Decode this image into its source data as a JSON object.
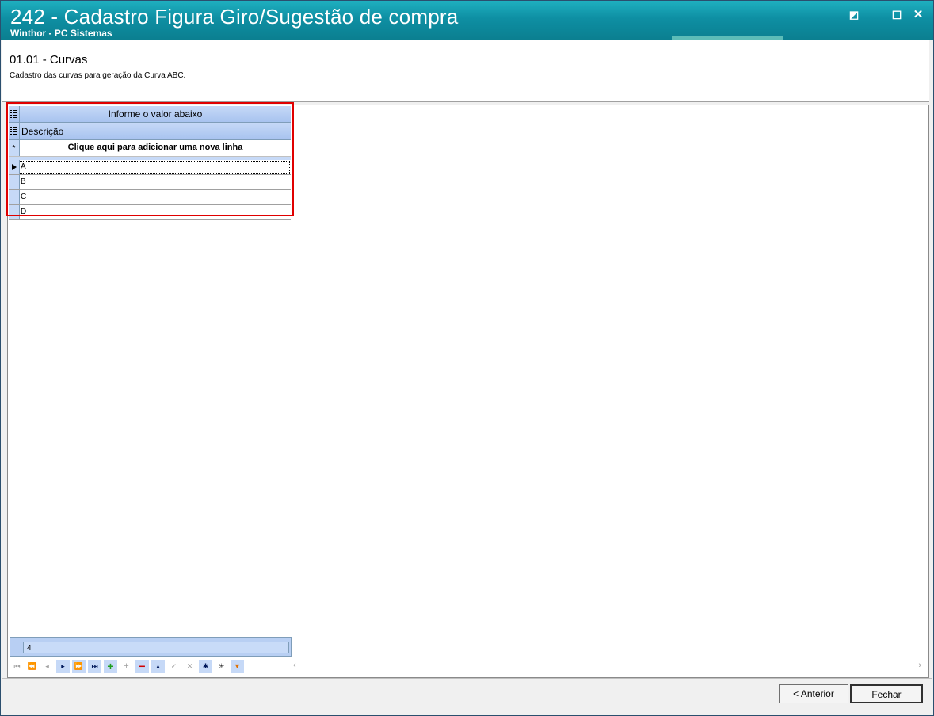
{
  "window": {
    "title": "242 - Cadastro Figura Giro/Sugestão de compra",
    "subtitle": "Winthor - PC Sistemas",
    "controls": {
      "restore": "◩",
      "minimize": "_",
      "maximize": "☐",
      "close": "✕"
    }
  },
  "step": {
    "title": "01.01 - Curvas",
    "description": "Cadastro das curvas para geração da Curva ABC."
  },
  "grid": {
    "group_header": "Informe o valor abaixo",
    "column_header": "Descrição",
    "new_row_text": "Clique aqui para adicionar uma nova linha",
    "new_row_indicator": "*",
    "rows": [
      {
        "descricao": "A"
      },
      {
        "descricao": "B"
      },
      {
        "descricao": "C"
      },
      {
        "descricao": "D"
      }
    ],
    "footer_count": "4"
  },
  "navigator": {
    "icons": [
      "first-icon",
      "prev-page-icon",
      "prev-icon",
      "next-icon",
      "next-page-icon",
      "last-icon",
      "insert-icon",
      "append-icon",
      "delete-icon",
      "edit-icon",
      "post-icon",
      "cancel-icon",
      "refresh-icon",
      "save-bookmark-icon",
      "filter-icon"
    ]
  },
  "buttons": {
    "anterior": "< Anterior",
    "fechar": "Fechar"
  },
  "colors": {
    "titlebar": "#0e8fa3",
    "grid_header": "#c6d9f7",
    "highlight": "#e00000"
  }
}
